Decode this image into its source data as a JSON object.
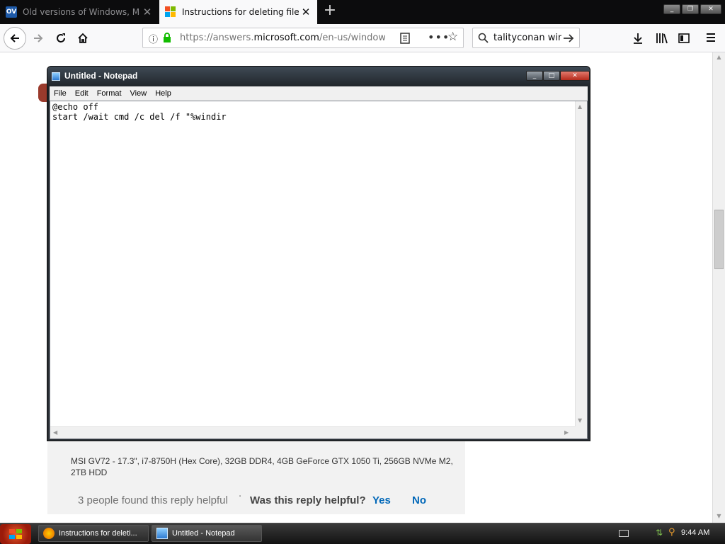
{
  "browser": {
    "tabs": [
      {
        "label": "Old versions of Windows, Mac and",
        "icon": "ov-icon",
        "favicon_text": "OV",
        "active": false
      },
      {
        "label": "Instructions for deleting files, using",
        "icon": "microsoft-icon",
        "active": true
      }
    ],
    "new_tab_symbol": "+",
    "window_controls": [
      "minimize",
      "maximize",
      "close"
    ],
    "url": {
      "prefix": "https://answers.",
      "domain": "microsoft.com",
      "suffix": "/en-us/windows/..."
    },
    "search": {
      "value": "talityconan wins"
    },
    "icons": [
      "back-icon",
      "forward-icon",
      "reload-icon",
      "home-icon",
      "info-icon",
      "lock-icon",
      "reader-icon",
      "more-icon",
      "bookmark-star-icon",
      "download-icon",
      "library-icon",
      "sidebar-icon",
      "menu-icon"
    ]
  },
  "page": {
    "specs": "MSI GV72 - 17.3\", i7-8750H (Hex Core), 32GB DDR4, 4GB GeForce GTX 1050 Ti, 256GB NVMe M2, 2TB HDD",
    "helpful_count": "3 people found this reply helpful",
    "separator": "·",
    "helpful_question": "Was this reply helpful?",
    "yes": "Yes",
    "no": "No"
  },
  "notepad": {
    "title": "Untitled - Notepad",
    "menu": [
      "File",
      "Edit",
      "Format",
      "View",
      "Help"
    ],
    "text": "@echo off\nstart /wait cmd /c del /f \"%windir"
  },
  "taskbar": {
    "tasks": [
      {
        "label": "Instructions for deleti...",
        "icon": "firefox-icon"
      },
      {
        "label": "Untitled - Notepad",
        "icon": "notepad-icon"
      }
    ],
    "clock": "9:44 AM"
  },
  "colors": {
    "link": "#0067b8",
    "tabbar": "#0c0c0d",
    "notepad_frame": "#2a2f35"
  }
}
